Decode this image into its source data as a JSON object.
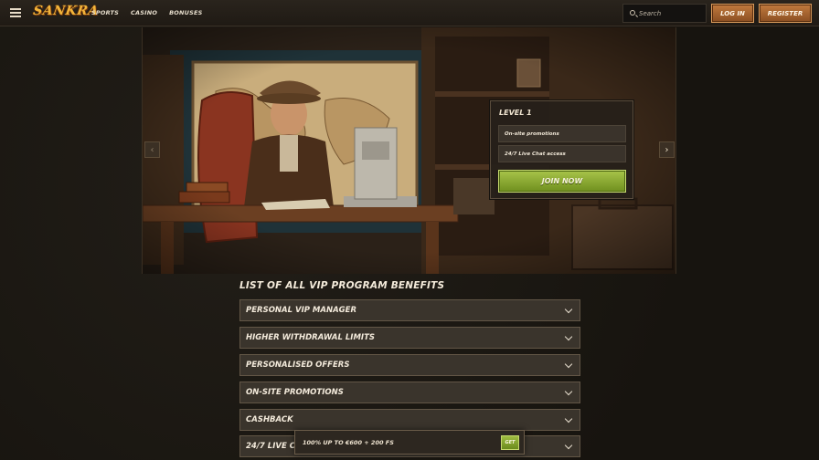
{
  "header": {
    "logo": "SANKRA",
    "nav": [
      "SPORTS",
      "CASINO",
      "BONUSES"
    ],
    "search_placeholder": "Search",
    "login_label": "LOG IN",
    "register_label": "REGISTER"
  },
  "hero": {
    "level_title": "LEVEL 1",
    "level_items": [
      "On-site promotions",
      "24/7 Live Chat access"
    ],
    "join_label": "JOIN NOW",
    "prev_icon": "chevron-left-icon",
    "next_icon": "chevron-right-icon"
  },
  "benefits": {
    "title": "LIST OF ALL VIP PROGRAM BENEFITS",
    "items": [
      "PERSONAL VIP MANAGER",
      "HIGHER WITHDRAWAL LIMITS",
      "PERSONALISED OFFERS",
      "ON-SITE PROMOTIONS",
      "CASHBACK",
      "24/7 LIVE C"
    ]
  },
  "bonus_bar": {
    "text": "100% UP TO €600 + 200 FS",
    "get_label": "GET"
  },
  "colors": {
    "accent_orange": "#b8733a",
    "accent_green": "#8aac32",
    "logo_gold": "#f2b43a",
    "background": "#1b1813"
  }
}
